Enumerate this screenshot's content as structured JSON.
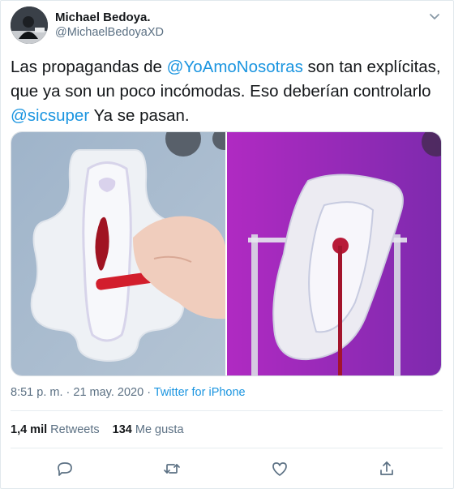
{
  "author": {
    "name": "Michael Bedoya.",
    "handle": "@MichaelBedoyaXD"
  },
  "tweet": {
    "text_1": "Las propagandas de ",
    "mention_1": "@YoAmoNosotras",
    "text_2": "  son tan explícitas, que ya son un poco incómodas. Eso deberían controlarlo ",
    "mention_2": "@sicsuper",
    "text_3": " Ya se pasan."
  },
  "meta": {
    "time": "8:51 p. m.",
    "sep_1": " · ",
    "date": "21 may. 2020",
    "sep_2": " · ",
    "source": "Twitter for iPhone"
  },
  "stats": {
    "retweets_count": "1,4 mil",
    "retweets_label": "Retweets",
    "likes_count": "134",
    "likes_label": "Me gusta"
  },
  "icons": {
    "menu": "chevron-down-icon",
    "reply": "reply-icon",
    "retweet": "retweet-icon",
    "like": "heart-icon",
    "share": "share-icon"
  },
  "colors": {
    "link": "#1b95e0",
    "secondary_text": "#5b7083",
    "primary_text": "#14171a",
    "left_photo_bg": "#a4b7cc",
    "right_photo_bg": "#9a2ab8",
    "accent_red": "#c0182a"
  }
}
